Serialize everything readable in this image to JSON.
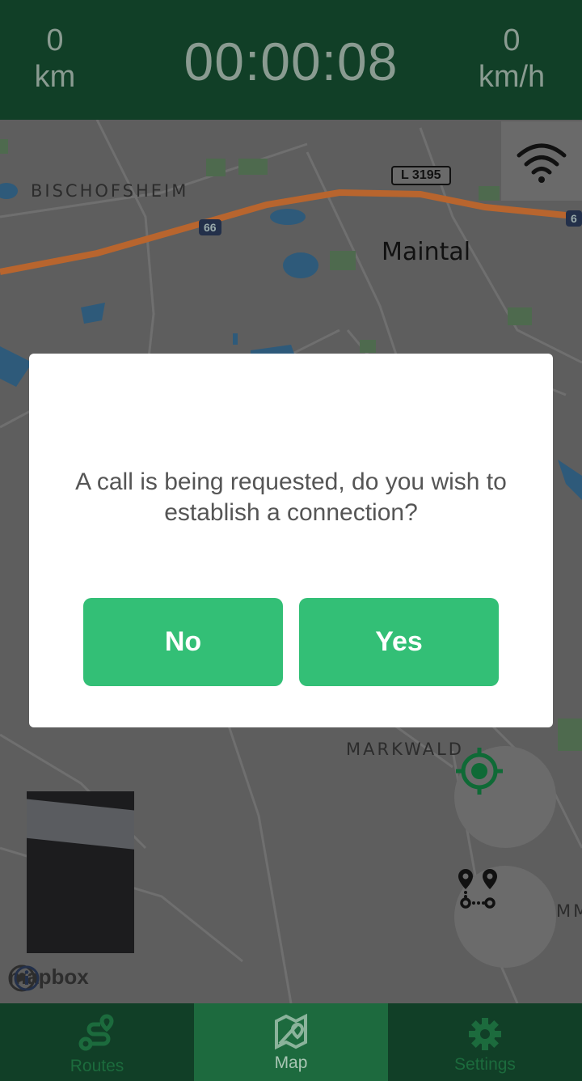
{
  "topbar": {
    "distance_value": "0",
    "distance_unit": "km",
    "timer": "00:00:08",
    "speed_value": "0",
    "speed_unit": "km/h"
  },
  "map": {
    "labels": {
      "bischofsheim": "BISCHOFSHEIM",
      "maintal": "Maintal",
      "markwald": "MARKWALD",
      "mm": "MM"
    },
    "road_shield": "L 3195",
    "highway_66": "66",
    "highway_edge": "6",
    "attribution": "mapbox"
  },
  "dialog": {
    "message": "A call is being requested, do you wish to establish a connection?",
    "no_label": "No",
    "yes_label": "Yes"
  },
  "bottom_nav": {
    "items": [
      {
        "label": "Routes",
        "icon": "routes-icon"
      },
      {
        "label": "Map",
        "icon": "map-icon"
      },
      {
        "label": "Settings",
        "icon": "gear-icon"
      }
    ],
    "active": "Map"
  },
  "colors": {
    "header_bg": "#113f27",
    "accent_green": "#33bf76",
    "nav_active_bg": "#1d6a3e"
  }
}
